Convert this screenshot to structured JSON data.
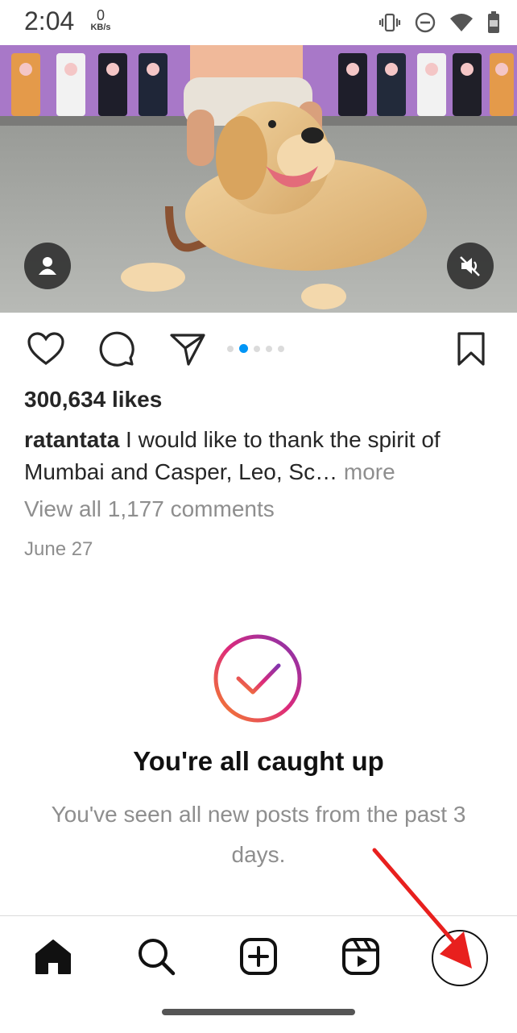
{
  "status_bar": {
    "time": "2:04",
    "net_speed_value": "0",
    "net_speed_unit": "KB/s"
  },
  "post": {
    "likes": "300,634 likes",
    "username": "ratantata",
    "caption": "I would like to thank the spirit of Mumbai and Casper, Leo, Sc",
    "ellipsis": "…",
    "more_label": "more",
    "view_comments": "View all 1,177 comments",
    "date": "June 27",
    "carousel": {
      "count": 5,
      "active_index": 1
    }
  },
  "caught_up": {
    "title": "You're all caught up",
    "subtitle": "You've seen all new posts from the past 3 days."
  },
  "nav": {
    "items": [
      "home-icon",
      "search-icon",
      "create-icon",
      "reels-icon",
      "profile-tab"
    ]
  },
  "colors": {
    "accent": "#0095f6",
    "annotation_arrow": "#e8201e",
    "gradient": [
      "#f58529",
      "#dd2a7b",
      "#8134af"
    ]
  }
}
